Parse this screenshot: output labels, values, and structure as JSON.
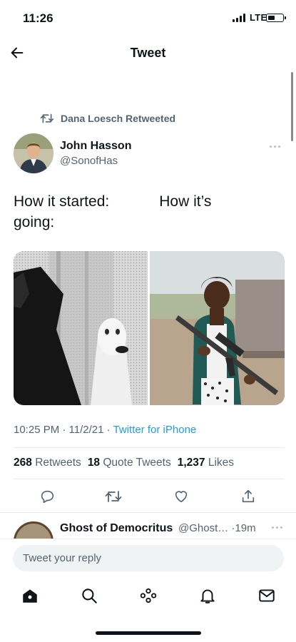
{
  "status": {
    "time": "11:26",
    "network": "LTE",
    "battery_level": 0.4
  },
  "header": {
    "title": "Tweet",
    "back_icon": "arrow-left-icon"
  },
  "retweet": {
    "label": "Dana Loesch Retweeted",
    "icon": "retweet-icon"
  },
  "author": {
    "name": "John Hasson",
    "handle": "@SonofHas"
  },
  "tweet": {
    "text": "How it started:            How it’s\ngoing:",
    "timestamp": "10:25 PM · 11/2/21 · ",
    "source": "Twitter for iPhone"
  },
  "stats": {
    "retweets_count": "268",
    "retweets_label": "Retweets",
    "quotes_count": "18",
    "quotes_label": "Quote Tweets",
    "likes_count": "1,237",
    "likes_label": "Likes"
  },
  "actions": [
    "reply-icon",
    "retweet-icon",
    "like-icon",
    "share-icon"
  ],
  "reply_preview": {
    "name": "Ghost of Democritus",
    "handle": "@Ghost…",
    "time": "·19m"
  },
  "reply_input": {
    "placeholder": "Tweet your reply"
  },
  "tabs": [
    "home-icon",
    "search-icon",
    "spaces-icon",
    "notifications-icon",
    "messages-icon"
  ],
  "colors": {
    "accent": "#1d9bf0",
    "text": "#0f1419",
    "secondary": "#536471"
  }
}
